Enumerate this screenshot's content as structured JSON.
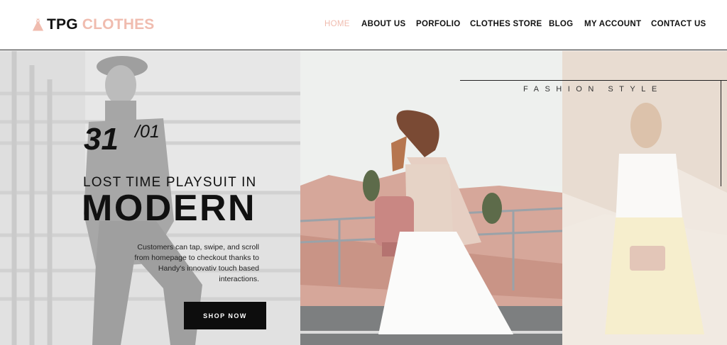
{
  "header": {
    "logo_primary": "TPG",
    "logo_secondary": "CLOTHES",
    "nav": [
      {
        "label": "HOME",
        "active": true
      },
      {
        "label": "ABOUT US",
        "active": false
      },
      {
        "label": "PORFOLIO",
        "active": false
      },
      {
        "label": "CLOTHES STORE",
        "active": false
      },
      {
        "label": "BLOG",
        "active": false
      },
      {
        "label": "MY ACCOUNT",
        "active": false
      },
      {
        "label": "CONTACT US",
        "active": false
      }
    ]
  },
  "hero": {
    "date_day": "31",
    "date_month": "/01",
    "subtitle": "LOST TIME PLAYSUIT IN",
    "headline": "MODERN",
    "description": "Customers can tap, swipe, and scroll from homepage to checkout thanks to Handy's innovativ touch based interactions.",
    "cta_label": "SHOP NOW",
    "side_caption": "FASHION STYLE"
  },
  "colors": {
    "accent": "#f0bcaf",
    "text": "#111111",
    "button_bg": "#0d0d0d"
  },
  "icons": {
    "logo": "dress-icon"
  }
}
